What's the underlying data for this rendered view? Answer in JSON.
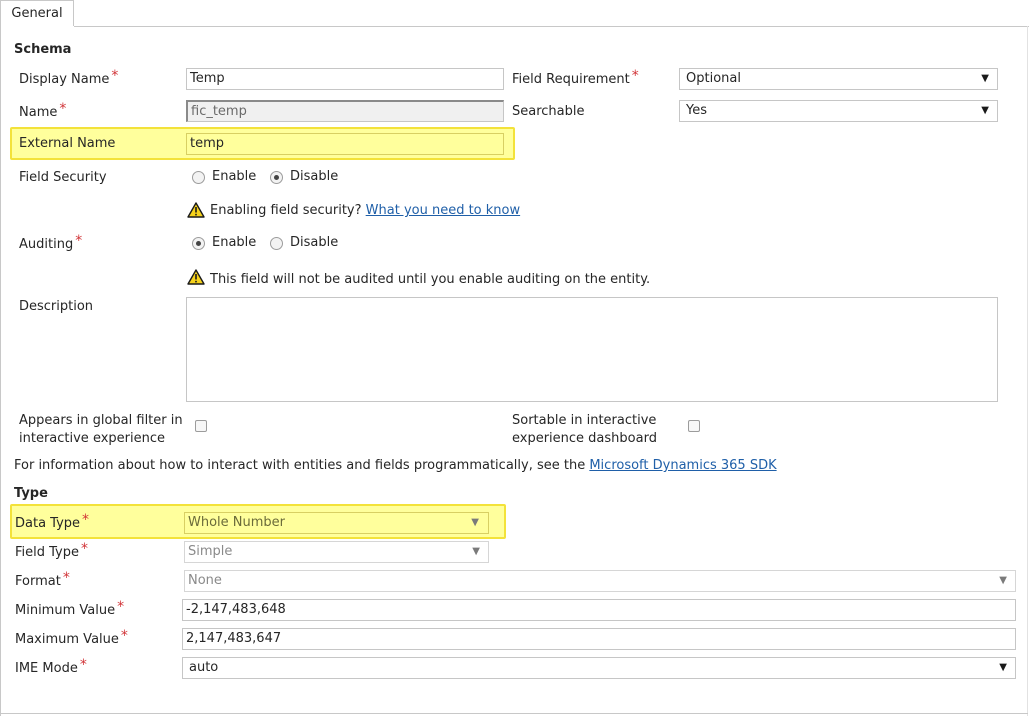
{
  "tabs": [
    {
      "label": "General"
    }
  ],
  "schema": {
    "heading": "Schema",
    "display_name": {
      "label": "Display Name",
      "value": "Temp"
    },
    "name": {
      "label": "Name",
      "value": "fic_temp"
    },
    "external_name": {
      "label": "External Name",
      "value": "temp"
    },
    "field_security": {
      "label": "Field Security",
      "options": [
        "Enable",
        "Disable"
      ],
      "selected": "Disable",
      "warning_text": "Enabling field security?",
      "warning_link": "What you need to know"
    },
    "auditing": {
      "label": "Auditing",
      "options": [
        "Enable",
        "Disable"
      ],
      "selected": "Enable",
      "warning_text": "This field will not be audited until you enable auditing on the entity."
    },
    "description": {
      "label": "Description",
      "value": ""
    },
    "field_requirement": {
      "label": "Field Requirement",
      "value": "Optional"
    },
    "searchable": {
      "label": "Searchable",
      "value": "Yes"
    },
    "global_filter": {
      "label_line1": "Appears in global filter in",
      "label_line2": "interactive experience",
      "checked": false
    },
    "sortable": {
      "label_line1": "Sortable in interactive",
      "label_line2": "experience dashboard",
      "checked": false
    },
    "sdk_info": {
      "text": "For information about how to interact with entities and fields programmatically, see the ",
      "link": "Microsoft Dynamics 365 SDK"
    }
  },
  "type": {
    "heading": "Type",
    "data_type": {
      "label": "Data Type",
      "value": "Whole Number"
    },
    "field_type": {
      "label": "Field Type",
      "value": "Simple"
    },
    "format": {
      "label": "Format",
      "value": "None"
    },
    "minimum_value": {
      "label": "Minimum Value",
      "value": "-2,147,483,648"
    },
    "maximum_value": {
      "label": "Maximum Value",
      "value": "2,147,483,647"
    },
    "ime_mode": {
      "label": "IME Mode",
      "value": "auto"
    }
  },
  "icons": {
    "required": "*",
    "dropdown": "▼"
  },
  "colors": {
    "highlight": "#ffff9c",
    "highlight_border": "#f3e23a",
    "required": "#d13438",
    "link": "#1f5fa8"
  }
}
